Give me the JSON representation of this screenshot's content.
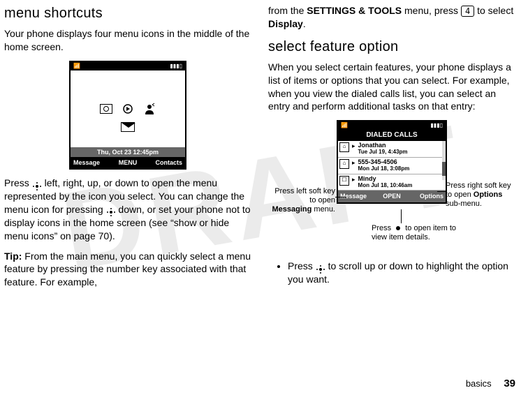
{
  "watermark": "DRAFT",
  "left": {
    "heading": "menu shortcuts",
    "intro": "Your phone displays four menu icons in the middle of the home screen.",
    "phone": {
      "date_line": "Thu, Oct 23 12:45pm",
      "softkeys": {
        "left": "Message",
        "center": "MENU",
        "right": "Contacts"
      }
    },
    "para2_a": "Press ",
    "para2_b": " left, right, up, or down to open the menu represented by the icon you select. You can change the menu icon for pressing ",
    "para2_c": " down, or set your phone not to display icons in the home screen (see “show or hide menu icons” on page 70).",
    "tip_label": "Tip:",
    "tip_text": " From the main menu, you can quickly select a menu feature by pressing the number key associated with that feature. For example,"
  },
  "right": {
    "cont_a": "from the ",
    "cont_menu": "SETTINGS & TOOLS",
    "cont_b": " menu, press ",
    "cont_key": "4",
    "cont_c": " to select ",
    "cont_item": "Display",
    "cont_d": ".",
    "heading2": "select feature option",
    "para": "When you select certain features, your phone displays a list of items or options that you can select. For example, when you view the dialed calls list, you can select an entry and perform additional tasks on that entry:",
    "phone": {
      "title": "DIALED CALLS",
      "rows": [
        {
          "name": "Jonathan",
          "time": "Tue Jul 19, 4:43pm"
        },
        {
          "name": "555-345-4506",
          "time": "Mon Jul 18, 3:08pm"
        },
        {
          "name": "Mindy",
          "time": "Mon Jul 18, 10:46am"
        }
      ],
      "softkeys": {
        "left": "Message",
        "center": "OPEN",
        "right": "Options"
      }
    },
    "callouts": {
      "left_a": "Press left soft key to open ",
      "left_b": "Messaging",
      "left_c": " menu.",
      "right_a": "Press right soft key to open ",
      "right_b": "Options",
      "right_c": " sub-menu.",
      "bottom_a": "Press ",
      "bottom_b": " to open item to view item details."
    },
    "bullet_a": "Press ",
    "bullet_b": " to scroll up or down to highlight the option you want."
  },
  "footer": {
    "section": "basics",
    "page": "39"
  }
}
